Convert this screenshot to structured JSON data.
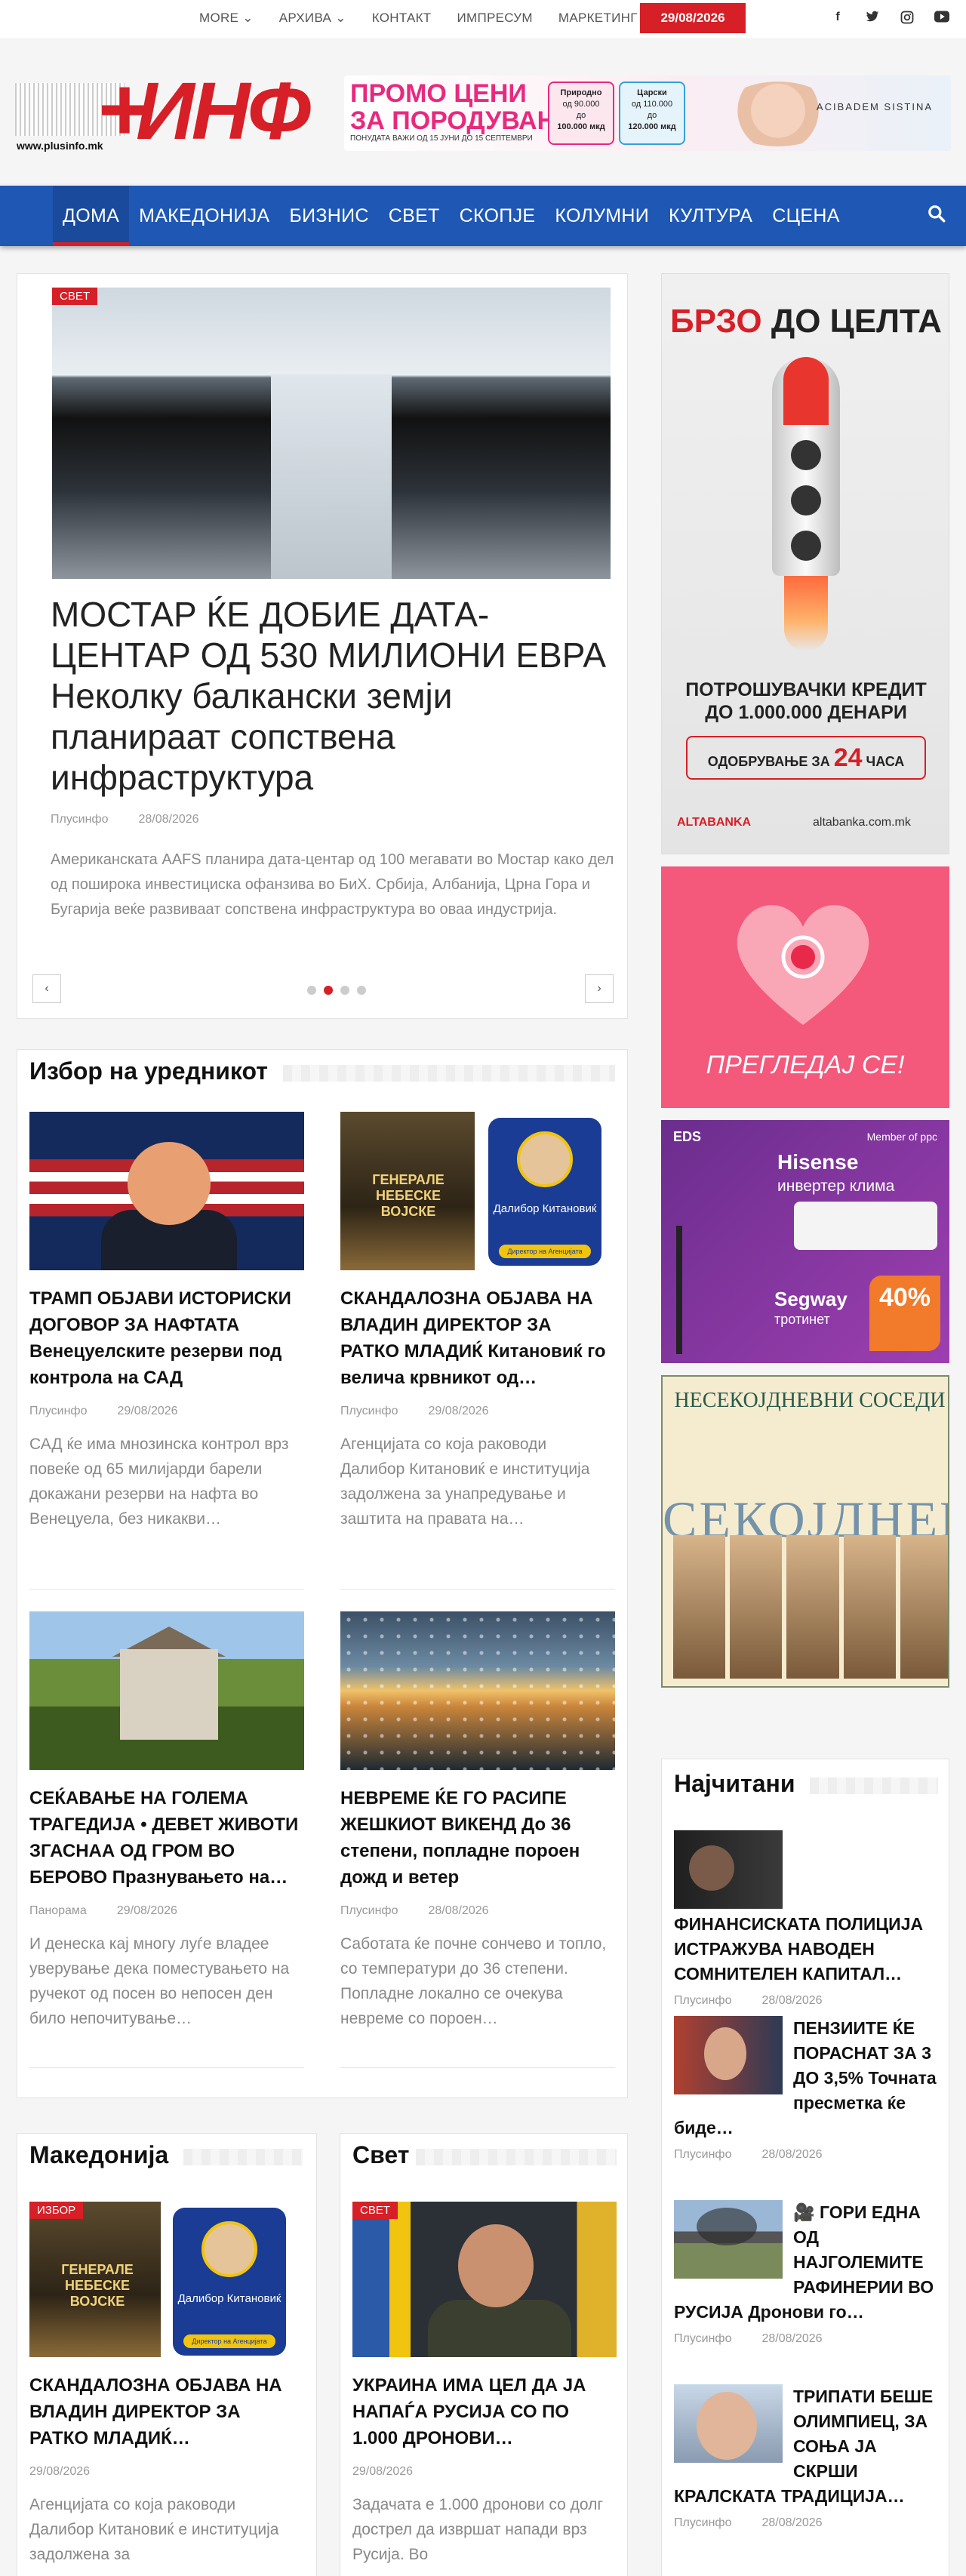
{
  "topbar": {
    "links": [
      "MORE ⌄",
      "АРХИВА ⌄",
      "КОНТАКТ",
      "ИМПРЕСУМ",
      "МАРКЕТИНГ"
    ],
    "date": "29/08/2026",
    "social": [
      "facebook-icon",
      "twitter-icon",
      "instagram-icon",
      "youtube-icon"
    ]
  },
  "header": {
    "logo_text": "ИНФ",
    "logo_url": "www.plusinfo.mk",
    "promo": {
      "title_line1": "ПРОМО ЦЕНИ",
      "title_line2": "ЗА ПОРОДУВАЊЕ",
      "note": "ПОНУДАТА ВАЖИ ОД 15 ЈУНИ ДО 15 СЕПТЕМВРИ",
      "box1": {
        "title": "Природно",
        "from": "од 90.000",
        "to": "до",
        "to_val": "100.000 мкд"
      },
      "box2": {
        "title": "Царски",
        "from": "од 110.000",
        "to": "до",
        "to_val": "120.000 мкд"
      },
      "brand": "ACIBADEM SISTINA"
    }
  },
  "nav": {
    "items": [
      "ДОМА",
      "МАКЕДОНИЈА",
      "БИЗНИС",
      "СВЕТ",
      "СКОПЈЕ",
      "КОЛУМНИ",
      "КУЛТУРА",
      "СЦЕНА"
    ]
  },
  "slider": {
    "category": "СВЕТ",
    "title": "МОСТАР ЌЕ ДОБИЕ ДАТА-ЦЕНТАР ОД 530 МИЛИОНИ ЕВРА Неколку балкански земји планираат сопствена инфраструктура",
    "author": "Плусинфо",
    "date": "28/08/2026",
    "excerpt": "Американската AAFS планира дата-центар од 100 мегавати во Мостар како дел од поширока инвестициска офанзива во БиХ. Србија, Албанија, Црна Гора и Бугарија веќе развиваат сопствена инфраструктура во оваа индустрија.",
    "prev": "‹",
    "next": "›"
  },
  "editor": {
    "title": "Избор на уредникот",
    "posts": [
      {
        "title": "ТРАМП ОБЈАВИ ИСТОРИСКИ ДОГОВОР ЗА НАФТАТА Венецуелските резерви под контрола на САД",
        "author": "Плусинфо",
        "date": "29/08/2026",
        "excerpt": "САД ќе има мнозинска контрол врз повеќе од 65 милијарди барели докажани резерви на нафта во Венецуела, без никакви…"
      },
      {
        "title": "СКАНДАЛОЗНА ОБЈАВА НА ВЛАДИН ДИРЕКТОР ЗА РАТКО МЛАДИЌ Китановиќ го велича крвникот од…",
        "author": "Плусинфо",
        "date": "29/08/2026",
        "excerpt": "Агенцијата со која раководи Далибор Китановиќ е институција задолжена за унапредување и заштита на правата на…"
      },
      {
        "title": "СЕЌАВАЊЕ НА ГОЛЕМА ТРАГЕДИЈА • ДЕВЕТ ЖИВОТИ ЗГАСНАА ОД ГРОМ ВО БЕРОВО Празнувањето на…",
        "author": "Панорама",
        "date": "29/08/2026",
        "excerpt": "И денеска кај многу луѓе владее уверување дека поместувањето на ручекот од посен во непосен ден било непочитување…"
      },
      {
        "title": "НЕВРЕМЕ ЌЕ ГО РАСИПЕ ЖЕШКИОТ ВИКЕНД До 36 степени, попладне пороен дожд и ветер",
        "author": "Плусинфо",
        "date": "28/08/2026",
        "excerpt": "Саботата ќе почне сончево и топло, со температури до 36 степени. Попладне локално се очекува невреме со пороен…"
      }
    ],
    "book_cover": "ГЕНЕРАЛЕ НЕБЕСКЕ ВОЈСКЕ",
    "badge_name": "Далибор Китановиќ",
    "badge_role": "Директор на Агенцијата"
  },
  "makedonija": {
    "title": "Македонија",
    "category": "ИЗБОР",
    "post": {
      "title": "СКАНДАЛОЗНА ОБЈАВА НА ВЛАДИН ДИРЕКТОР ЗА РАТКО МЛАДИЌ…",
      "date": "29/08/2026",
      "excerpt": "Агенцијата со која раководи Далибор Китановиќ е институција задолжена за"
    }
  },
  "svet": {
    "title": "Свет",
    "category": "СВЕТ",
    "post": {
      "title": "УКРАИНА ИМА ЦЕЛ ДА ЈА НАПАЃА РУСИЈА СО ПО 1.000 ДРОНОВИ…",
      "date": "29/08/2026",
      "excerpt": "Задачата е 1.000 дронови со долг дострел да извршат напади врз Русија. Во"
    }
  },
  "ads": {
    "ad1": {
      "head_red": "БРЗО",
      "head_dark": "ДО ЦЕЛТА",
      "line1": "ПОТРОШУВАЧКИ КРЕДИТ",
      "line2": "ДО 1.000.000 ДЕНАРИ",
      "btn_pre": "ОДОБРУВАЊЕ ЗА",
      "btn_num": "24",
      "btn_post": "ЧАСА",
      "brand": "ALTABANKA",
      "site": "altabanka.com.mk"
    },
    "ad2": {
      "text": "ПРЕГЛЕДАЈ СЕ!"
    },
    "ad3": {
      "eds": "EDS",
      "ppc": "Member of ppc",
      "brand": "Hisense",
      "product": "инвертер клима",
      "scooter_brand": "Segway",
      "scooter": "тротинет",
      "pct": "40%"
    },
    "ad4": {
      "title": "НЕСЕКОЈДНЕВНИ СОСЕДИ",
      "big": "СЕКОЈДНЕВН"
    }
  },
  "popular": {
    "title": "Најчитани",
    "items": [
      {
        "title": "ФИНАНСИСКАТА ПОЛИЦИЈА ИСТРАЖУВА НАВОДЕН СОМНИТЕЛЕН КАПИТАЛ…",
        "author": "Плусинфо",
        "date": "28/08/2026"
      },
      {
        "title": "ПЕНЗИИТЕ ЌЕ ПОРАСНАТ ЗА 3 ДО 3,5% Точната пресметка ќе биде…",
        "author": "Плусинфо",
        "date": "28/08/2026"
      },
      {
        "title": "🎥 ГОРИ ЕДНА ОД НАЈГОЛЕМИТЕ РАФИНЕРИИ ВО РУСИЈА Дронови го…",
        "author": "Плусинфо",
        "date": "28/08/2026"
      },
      {
        "title": "ТРИПАТИ БЕШЕ ОЛИМПИЕЦ, ЗА СОЊА ЈА СКРШИ КРАЛСКАТА ТРАДИЦИЈА…",
        "author": "Плусинфо",
        "date": "28/08/2026"
      }
    ]
  }
}
